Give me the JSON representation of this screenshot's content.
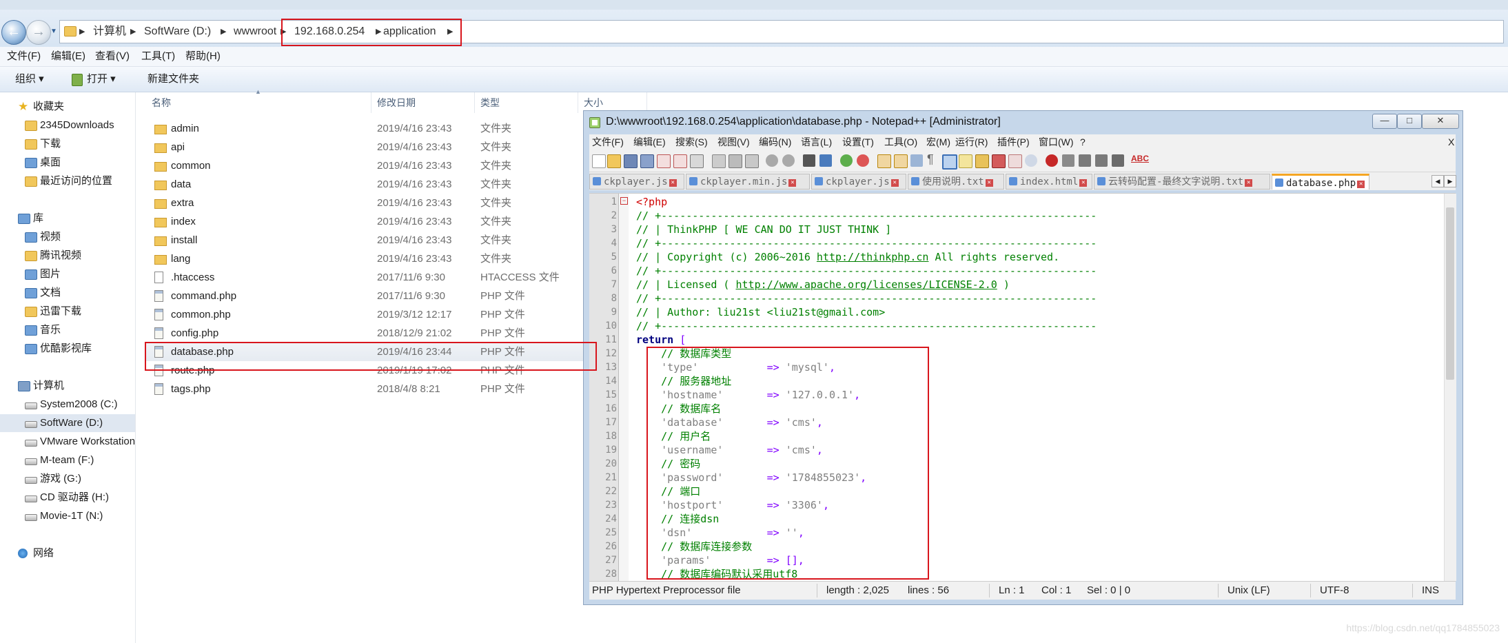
{
  "explorer": {
    "breadcrumbs": [
      "计算机",
      "SoftWare (D:)",
      "wwwroot",
      "192.168.0.254",
      "application"
    ],
    "menu": [
      "文件(F)",
      "编辑(E)",
      "查看(V)",
      "工具(T)",
      "帮助(H)"
    ],
    "commands": [
      "组织 ▾",
      "打开 ▾",
      "新建文件夹"
    ],
    "nav": {
      "favorites_header": "收藏夹",
      "favorites": [
        "2345Downloads",
        "下载",
        "桌面",
        "最近访问的位置"
      ],
      "library_header": "库",
      "libraries": [
        "视频",
        "腾讯视频",
        "图片",
        "文档",
        "迅雷下载",
        "音乐",
        "优酷影视库"
      ],
      "computer_header": "计算机",
      "drives": [
        "System2008 (C:)",
        "SoftWare (D:)",
        "VMware Workstation",
        "M-team (F:)",
        "游戏 (G:)",
        "CD 驱动器 (H:)",
        "Movie-1T (N:)"
      ],
      "network": "网络"
    },
    "columns": {
      "name": "名称",
      "modified": "修改日期",
      "type": "类型",
      "size": "大小"
    },
    "files": [
      {
        "name": "admin",
        "modified": "2019/4/16 23:43",
        "type": "文件夹",
        "kind": "folder"
      },
      {
        "name": "api",
        "modified": "2019/4/16 23:43",
        "type": "文件夹",
        "kind": "folder"
      },
      {
        "name": "common",
        "modified": "2019/4/16 23:43",
        "type": "文件夹",
        "kind": "folder"
      },
      {
        "name": "data",
        "modified": "2019/4/16 23:43",
        "type": "文件夹",
        "kind": "folder"
      },
      {
        "name": "extra",
        "modified": "2019/4/16 23:43",
        "type": "文件夹",
        "kind": "folder"
      },
      {
        "name": "index",
        "modified": "2019/4/16 23:43",
        "type": "文件夹",
        "kind": "folder"
      },
      {
        "name": "install",
        "modified": "2019/4/16 23:43",
        "type": "文件夹",
        "kind": "folder"
      },
      {
        "name": "lang",
        "modified": "2019/4/16 23:43",
        "type": "文件夹",
        "kind": "folder"
      },
      {
        "name": ".htaccess",
        "modified": "2017/11/6 9:30",
        "type": "HTACCESS 文件",
        "kind": "doc"
      },
      {
        "name": "command.php",
        "modified": "2017/11/6 9:30",
        "type": "PHP 文件",
        "kind": "php"
      },
      {
        "name": "common.php",
        "modified": "2019/3/12 12:17",
        "type": "PHP 文件",
        "kind": "php"
      },
      {
        "name": "config.php",
        "modified": "2018/12/9 21:02",
        "type": "PHP 文件",
        "kind": "php"
      },
      {
        "name": "database.php",
        "modified": "2019/4/16 23:44",
        "type": "PHP 文件",
        "kind": "php"
      },
      {
        "name": "route.php",
        "modified": "2019/1/19 17:02",
        "type": "PHP 文件",
        "kind": "php"
      },
      {
        "name": "tags.php",
        "modified": "2018/4/8 8:21",
        "type": "PHP 文件",
        "kind": "php"
      }
    ]
  },
  "notepad": {
    "title": "D:\\wwwroot\\192.168.0.254\\application\\database.php - Notepad++ [Administrator]",
    "menu": [
      "文件(F)",
      "编辑(E)",
      "搜索(S)",
      "视图(V)",
      "编码(N)",
      "语言(L)",
      "设置(T)",
      "工具(O)",
      "宏(M)",
      "运行(R)",
      "插件(P)",
      "窗口(W)",
      "?"
    ],
    "close_x": "X",
    "spellcheck": "ABC",
    "tabs": [
      "ckplayer.js",
      "ckplayer.min.js",
      "ckplayer.js",
      "使用说明.txt",
      "index.html",
      "云转码配置-最终文字说明.txt",
      "database.php"
    ],
    "lines": [
      {
        "n": "1",
        "segs": [
          {
            "c": "php",
            "t": "<?php"
          }
        ]
      },
      {
        "n": "2",
        "segs": [
          {
            "c": "cm",
            "t": "// +----------------------------------------------------------------------"
          }
        ]
      },
      {
        "n": "3",
        "segs": [
          {
            "c": "cm",
            "t": "// | ThinkPHP [ WE CAN DO IT JUST THINK ]"
          }
        ]
      },
      {
        "n": "4",
        "segs": [
          {
            "c": "cm",
            "t": "// +----------------------------------------------------------------------"
          }
        ]
      },
      {
        "n": "5",
        "segs": [
          {
            "c": "cm",
            "t": "// | Copyright (c) 2006~2016 "
          },
          {
            "c": "cm url",
            "t": "http://thinkphp.cn"
          },
          {
            "c": "cm",
            "t": " All rights reserved."
          }
        ]
      },
      {
        "n": "6",
        "segs": [
          {
            "c": "cm",
            "t": "// +----------------------------------------------------------------------"
          }
        ]
      },
      {
        "n": "7",
        "segs": [
          {
            "c": "cm",
            "t": "// | Licensed ( "
          },
          {
            "c": "cm url",
            "t": "http://www.apache.org/licenses/LICENSE-2.0"
          },
          {
            "c": "cm",
            "t": " )"
          }
        ]
      },
      {
        "n": "8",
        "segs": [
          {
            "c": "cm",
            "t": "// +----------------------------------------------------------------------"
          }
        ]
      },
      {
        "n": "9",
        "segs": [
          {
            "c": "cm",
            "t": "// | Author: liu21st <liu21st@gmail.com>"
          }
        ]
      },
      {
        "n": "10",
        "segs": [
          {
            "c": "cm",
            "t": "// +----------------------------------------------------------------------"
          }
        ]
      },
      {
        "n": "11",
        "segs": [
          {
            "c": "kw",
            "t": "return"
          },
          {
            "c": "op",
            "t": " ["
          }
        ]
      },
      {
        "n": "12",
        "segs": [
          {
            "c": "cm",
            "t": "    // 数据库类型"
          }
        ]
      },
      {
        "n": "13",
        "segs": [
          {
            "c": "str",
            "t": "    'type'"
          },
          {
            "c": "op",
            "t": "           => "
          },
          {
            "c": "str",
            "t": "'mysql'"
          },
          {
            "c": "op",
            "t": ","
          }
        ]
      },
      {
        "n": "14",
        "segs": [
          {
            "c": "cm",
            "t": "    // 服务器地址"
          }
        ]
      },
      {
        "n": "15",
        "segs": [
          {
            "c": "str",
            "t": "    'hostname'"
          },
          {
            "c": "op",
            "t": "       => "
          },
          {
            "c": "str",
            "t": "'127.0.0.1'"
          },
          {
            "c": "op",
            "t": ","
          }
        ]
      },
      {
        "n": "16",
        "segs": [
          {
            "c": "cm",
            "t": "    // 数据库名"
          }
        ]
      },
      {
        "n": "17",
        "segs": [
          {
            "c": "str",
            "t": "    'database'"
          },
          {
            "c": "op",
            "t": "       => "
          },
          {
            "c": "str",
            "t": "'cms'"
          },
          {
            "c": "op",
            "t": ","
          }
        ]
      },
      {
        "n": "18",
        "segs": [
          {
            "c": "cm",
            "t": "    // 用户名"
          }
        ]
      },
      {
        "n": "19",
        "segs": [
          {
            "c": "str",
            "t": "    'username'"
          },
          {
            "c": "op",
            "t": "       => "
          },
          {
            "c": "str",
            "t": "'cms'"
          },
          {
            "c": "op",
            "t": ","
          }
        ]
      },
      {
        "n": "20",
        "segs": [
          {
            "c": "cm",
            "t": "    // 密码"
          }
        ]
      },
      {
        "n": "21",
        "segs": [
          {
            "c": "str",
            "t": "    'password'"
          },
          {
            "c": "op",
            "t": "       => "
          },
          {
            "c": "str",
            "t": "'1784855023'"
          },
          {
            "c": "op",
            "t": ","
          }
        ]
      },
      {
        "n": "22",
        "segs": [
          {
            "c": "cm",
            "t": "    // 端口"
          }
        ]
      },
      {
        "n": "23",
        "segs": [
          {
            "c": "str",
            "t": "    'hostport'"
          },
          {
            "c": "op",
            "t": "       => "
          },
          {
            "c": "str",
            "t": "'3306'"
          },
          {
            "c": "op",
            "t": ","
          }
        ]
      },
      {
        "n": "24",
        "segs": [
          {
            "c": "cm",
            "t": "    // 连接dsn"
          }
        ]
      },
      {
        "n": "25",
        "segs": [
          {
            "c": "str",
            "t": "    'dsn'"
          },
          {
            "c": "op",
            "t": "            => "
          },
          {
            "c": "str",
            "t": "''"
          },
          {
            "c": "op",
            "t": ","
          }
        ]
      },
      {
        "n": "26",
        "segs": [
          {
            "c": "cm",
            "t": "    // 数据库连接参数"
          }
        ]
      },
      {
        "n": "27",
        "segs": [
          {
            "c": "str",
            "t": "    'params'"
          },
          {
            "c": "op",
            "t": "         => [],"
          }
        ]
      },
      {
        "n": "28",
        "segs": [
          {
            "c": "cm",
            "t": "    // 数据库编码默认采用utf8"
          }
        ]
      }
    ],
    "status": {
      "filetype": "PHP Hypertext Preprocessor file",
      "length": "length : 2,025",
      "lines": "lines : 56",
      "ln": "Ln : 1",
      "col": "Col : 1",
      "sel": "Sel : 0 | 0",
      "eol": "Unix (LF)",
      "encoding": "UTF-8",
      "mode": "INS"
    }
  },
  "watermark": "https://blog.csdn.net/qq1784855023"
}
